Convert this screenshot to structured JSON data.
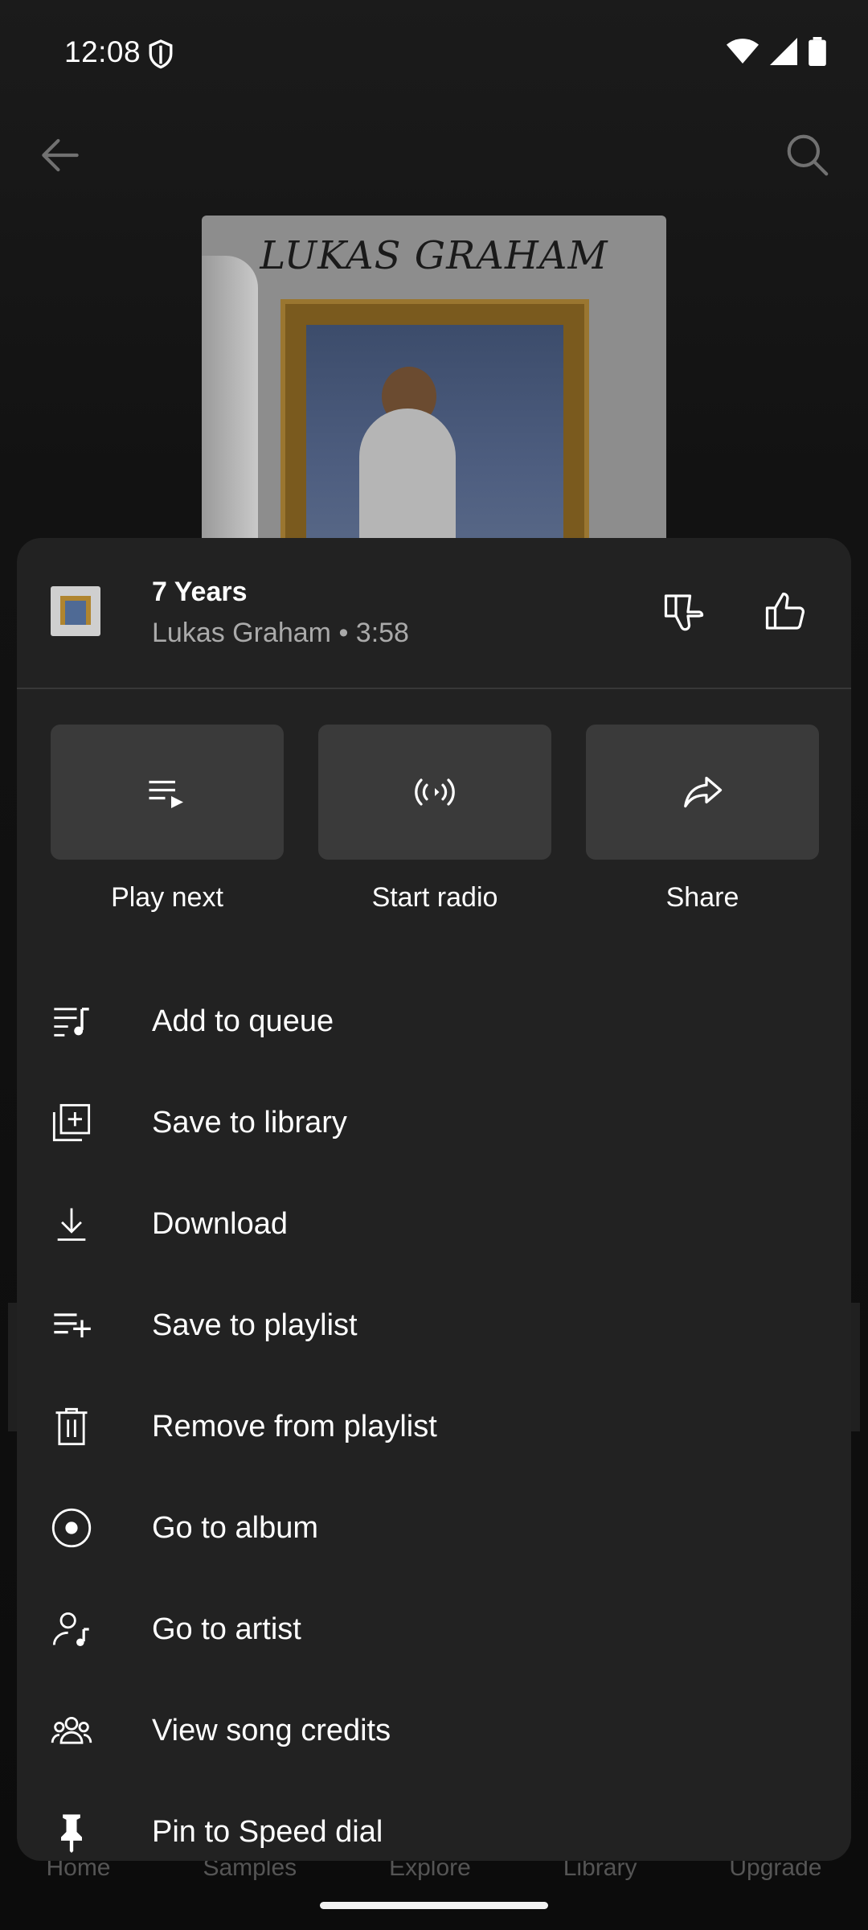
{
  "status_bar": {
    "time": "12:08",
    "icons": [
      "shield-icon",
      "wifi-icon",
      "signal-icon",
      "battery-icon"
    ]
  },
  "background": {
    "album_art_text": "LUKAS GRAHAM",
    "bottom_nav": [
      "Home",
      "Samples",
      "Explore",
      "Library",
      "Upgrade"
    ]
  },
  "song": {
    "title": "7 Years",
    "subtitle": "Lukas Graham • 3:58"
  },
  "quick_actions": [
    {
      "label": "Play next",
      "icon": "play-next-icon"
    },
    {
      "label": "Start radio",
      "icon": "radio-icon"
    },
    {
      "label": "Share",
      "icon": "share-icon"
    }
  ],
  "menu": [
    {
      "label": "Add to queue",
      "icon": "queue-music-icon"
    },
    {
      "label": "Save to library",
      "icon": "library-add-icon"
    },
    {
      "label": "Download",
      "icon": "download-icon"
    },
    {
      "label": "Save to playlist",
      "icon": "playlist-add-icon"
    },
    {
      "label": "Remove from playlist",
      "icon": "trash-icon"
    },
    {
      "label": "Go to album",
      "icon": "album-icon"
    },
    {
      "label": "Go to artist",
      "icon": "artist-icon"
    },
    {
      "label": "View song credits",
      "icon": "credits-icon"
    },
    {
      "label": "Pin to Speed dial",
      "icon": "pin-icon"
    }
  ],
  "colors": {
    "sheet_bg": "#222222",
    "tile_bg": "#3a3a3a",
    "secondary_text": "#aaaaaa"
  }
}
